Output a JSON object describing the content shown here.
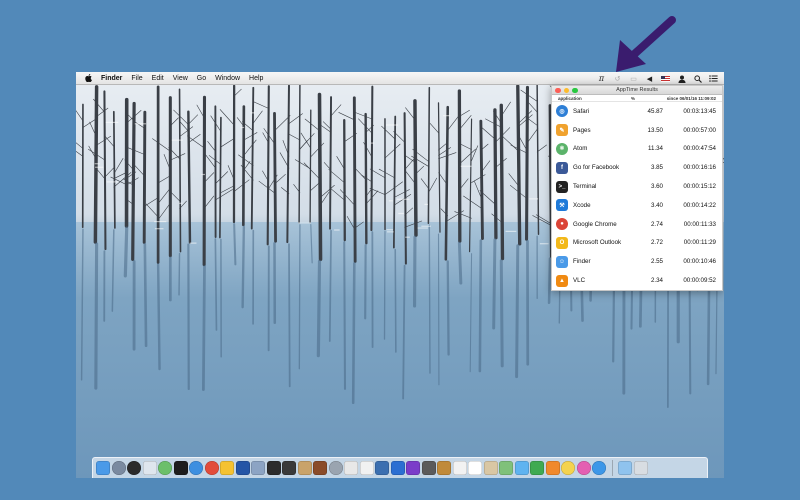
{
  "menubar": {
    "app_name": "Finder",
    "menus": [
      "File",
      "Edit",
      "View",
      "Go",
      "Window",
      "Help"
    ],
    "status_icons": [
      "apptime-icon",
      "time-machine-icon",
      "airplay-icon",
      "volume-icon",
      "flag-us-icon",
      "user-icon",
      "spotlight-icon",
      "notification-center-icon"
    ]
  },
  "apptime": {
    "title": "AppTime Results",
    "col_application": "application",
    "col_percent": "%",
    "col_since": "since 06/01/16 11:09:02",
    "rows": [
      {
        "name": "Safari",
        "percent": "45.87",
        "time": "00:03:13:45",
        "icon": "safari-icon",
        "color": "#2e7fd6"
      },
      {
        "name": "Pages",
        "percent": "13.50",
        "time": "00:00:57:00",
        "icon": "pages-icon",
        "color": "#f0a22e"
      },
      {
        "name": "Atom",
        "percent": "11.34",
        "time": "00:00:47:54",
        "icon": "atom-icon",
        "color": "#5bb36a"
      },
      {
        "name": "Go for Facebook",
        "percent": "3.85",
        "time": "00:00:16:16",
        "icon": "facebook-icon",
        "color": "#3b5998"
      },
      {
        "name": "Terminal",
        "percent": "3.60",
        "time": "00:00:15:12",
        "icon": "terminal-icon",
        "color": "#222222"
      },
      {
        "name": "Xcode",
        "percent": "3.40",
        "time": "00:00:14:22",
        "icon": "xcode-icon",
        "color": "#1f7ad9"
      },
      {
        "name": "Google Chrome",
        "percent": "2.74",
        "time": "00:00:11:33",
        "icon": "chrome-icon",
        "color": "#db4437"
      },
      {
        "name": "Microsoft Outlook",
        "percent": "2.72",
        "time": "00:00:11:29",
        "icon": "outlook-icon",
        "color": "#f2b81a"
      },
      {
        "name": "Finder",
        "percent": "2.55",
        "time": "00:00:10:46",
        "icon": "finder-icon",
        "color": "#4a9ae8"
      },
      {
        "name": "VLC",
        "percent": "2.34",
        "time": "00:00:09:52",
        "icon": "vlc-icon",
        "color": "#f08a12"
      }
    ]
  },
  "dock": {
    "items": [
      {
        "icon": "finder-icon",
        "color": "#4a9ae8"
      },
      {
        "icon": "launchpad-icon",
        "color": "#7a8aa0"
      },
      {
        "icon": "dashboard-icon",
        "color": "#2b2b2b"
      },
      {
        "icon": "script-editor-icon",
        "color": "#dfe6ee"
      },
      {
        "icon": "atom-icon",
        "color": "#6cbf6a"
      },
      {
        "icon": "terminal-icon",
        "color": "#1d1d1d"
      },
      {
        "icon": "safari-icon",
        "color": "#3d8fe0"
      },
      {
        "icon": "chrome-icon",
        "color": "#e24c3b"
      },
      {
        "icon": "sketch-icon",
        "color": "#f5c231"
      },
      {
        "icon": "sequel-pro-icon",
        "color": "#2455a6"
      },
      {
        "icon": "virtualbox-icon",
        "color": "#8ca4c4"
      },
      {
        "icon": "activity-monitor-icon",
        "color": "#2c2c2c"
      },
      {
        "icon": "console-icon",
        "color": "#3a3a3a"
      },
      {
        "icon": "installer-icon",
        "color": "#c9a36a"
      },
      {
        "icon": "brush-icon",
        "color": "#8a4c2a"
      },
      {
        "icon": "search-icon",
        "color": "#9aa4b0"
      },
      {
        "icon": "textedit-icon",
        "color": "#e8e8e8"
      },
      {
        "icon": "preview-icon",
        "color": "#f1f1f1"
      },
      {
        "icon": "photo-icon",
        "color": "#3b6fb0"
      },
      {
        "icon": "affinity-designer-icon",
        "color": "#2c6fd2"
      },
      {
        "icon": "affinity-photo-icon",
        "color": "#7b3cc9"
      },
      {
        "icon": "tool-icon",
        "color": "#5b5b5b"
      },
      {
        "icon": "notes-icon",
        "color": "#c08a3a"
      },
      {
        "icon": "reminders-icon",
        "color": "#f2f2f2"
      },
      {
        "icon": "calendar-icon",
        "color": "#ffffff"
      },
      {
        "icon": "contacts-icon",
        "color": "#d9c7a4"
      },
      {
        "icon": "maps-icon",
        "color": "#7fc17a"
      },
      {
        "icon": "messages-icon",
        "color": "#5fb3f0"
      },
      {
        "icon": "facetime-icon",
        "color": "#3faa52"
      },
      {
        "icon": "ibooks-icon",
        "color": "#f0892c"
      },
      {
        "icon": "photos-icon",
        "color": "#f4d34e"
      },
      {
        "icon": "itunes-icon",
        "color": "#e45fb2"
      },
      {
        "icon": "app-store-icon",
        "color": "#3c97e8"
      }
    ],
    "right_items": [
      {
        "icon": "downloads-folder-icon",
        "color": "#8fc3ee"
      },
      {
        "icon": "trash-icon",
        "color": "#d8dde2"
      }
    ]
  }
}
